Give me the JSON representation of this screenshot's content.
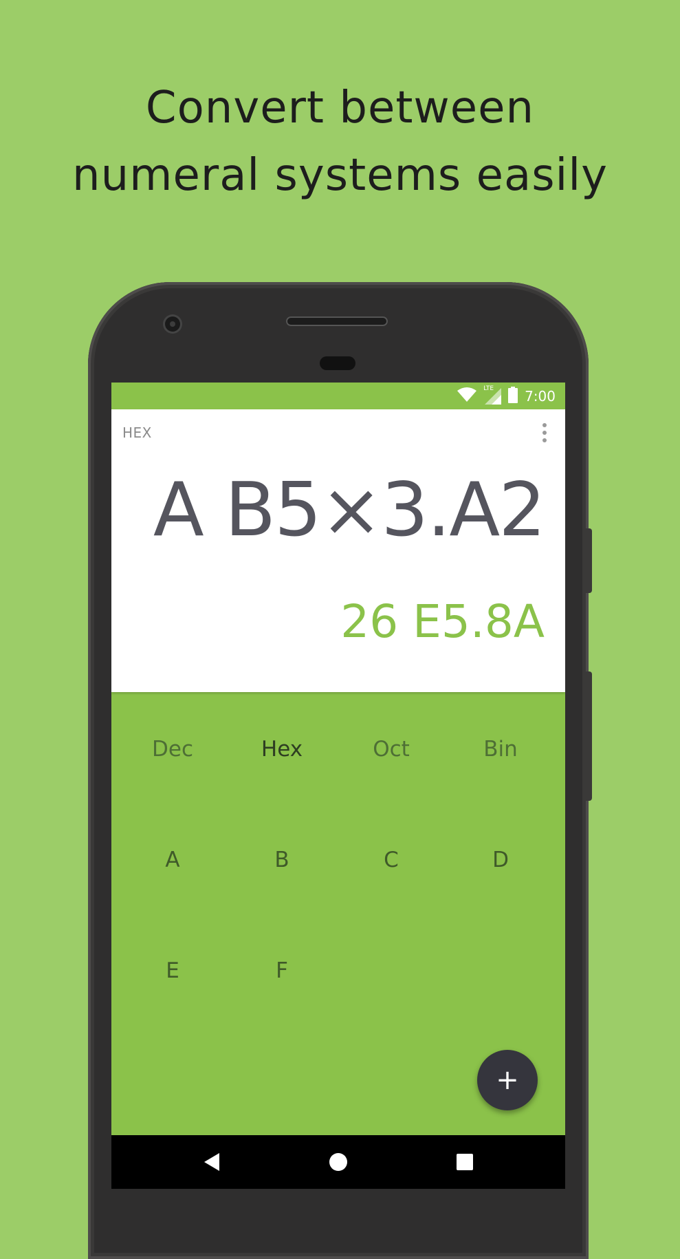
{
  "headline": {
    "line1": "Convert between",
    "line2": "numeral systems easily"
  },
  "status_bar": {
    "time": "7:00",
    "network": "LTE",
    "icons": [
      "wifi-icon",
      "signal-icon",
      "battery-icon"
    ]
  },
  "display": {
    "mode_label": "HEX",
    "expression": "A B5×3.A2",
    "result": "26 E5.8A"
  },
  "keypad": {
    "bases": [
      {
        "label": "Dec",
        "active": false
      },
      {
        "label": "Hex",
        "active": true
      },
      {
        "label": "Oct",
        "active": false
      },
      {
        "label": "Bin",
        "active": false
      }
    ],
    "digits": [
      "A",
      "B",
      "C",
      "D",
      "E",
      "F"
    ]
  },
  "fab": {
    "label": "+",
    "icon": "plus-icon"
  },
  "nav": {
    "icons": [
      "back-icon",
      "home-icon",
      "recents-icon"
    ]
  },
  "colors": {
    "background": "#9ccd68",
    "accent": "#8bc24a",
    "fab": "#35353d"
  }
}
